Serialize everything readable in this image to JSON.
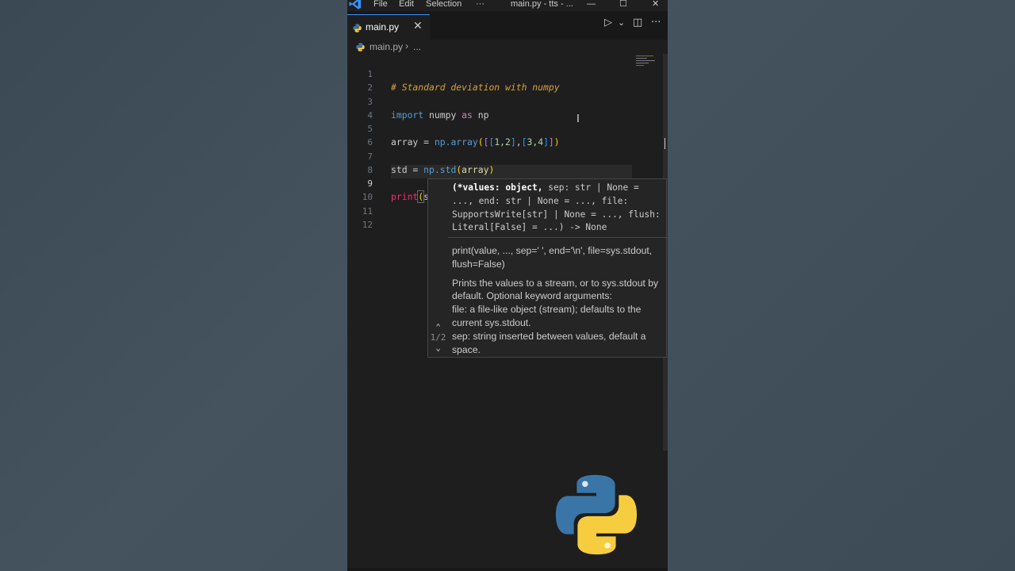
{
  "titlebar": {
    "menu": [
      "File",
      "Edit",
      "Selection",
      "···"
    ],
    "title": "main.py - tts - ...",
    "controls": [
      "—",
      "☐",
      "✕"
    ]
  },
  "tab": {
    "label": "main.py",
    "close": "✕"
  },
  "tab_actions": [
    "▷",
    "⌄",
    "◫",
    "···"
  ],
  "breadcrumb": {
    "file": "main.py",
    "separator": "›",
    "more": "..."
  },
  "editor": {
    "line_numbers": [
      "1",
      "2",
      "3",
      "4",
      "5",
      "6",
      "7",
      "8",
      "9",
      "10",
      "11",
      "12"
    ],
    "active_line": "9",
    "code": {
      "l1": "# Standard deviation with numpy",
      "l3_kw": "import",
      "l3_mod": " numpy ",
      "l3_as": "as",
      "l3_alias": " np",
      "l5_var": "array = ",
      "l5_call": "np.array",
      "l5_open": "(",
      "l5_b1": "[",
      "l5_b2": "[",
      "l5_n1": "1,2",
      "l5_b3": "]",
      "l5_comma": ",",
      "l5_b4": "[",
      "l5_n2": "3,4",
      "l5_b5": "]",
      "l5_b6": "]",
      "l5_close": ")",
      "l7_var": "std = ",
      "l7_call": "np.std",
      "l7_open": "(",
      "l7_arg": "array",
      "l7_close": ")",
      "l9_fn": "print",
      "l9_open": "(",
      "l9_arg": "s",
      "l9_close": ")"
    }
  },
  "popup": {
    "sig_bold": "(*values: object,",
    "sig_rest": " sep: str | None =\n..., end: str | None = ..., file:\nSupportsWrite[str] | None = ..., flush:\nLiteral[False] = ...) -> None",
    "doc_signature": "print(value, ..., sep=' ', end='\\n', file=sys.stdout, flush=False)",
    "doc_desc": "Prints the values to a stream, or to sys.stdout by default. Optional keyword arguments:",
    "doc_file": "file: a file-like object (stream); defaults to the current sys.stdout.",
    "doc_sep": "sep: string inserted between values, default a space.",
    "nav_up": "⌃",
    "nav_count": "1/2",
    "nav_down": "⌄"
  },
  "colors": {
    "editor_bg": "#1e1e1e",
    "accent": "#3794ff",
    "comment": "#d7a13b",
    "keyword": "#c586c0"
  }
}
